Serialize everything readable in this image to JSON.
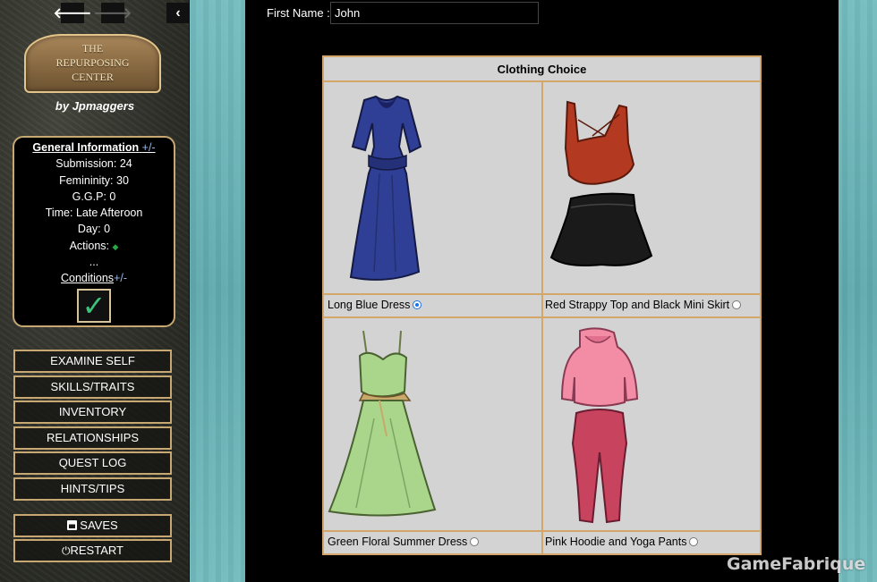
{
  "logo": {
    "line1": "THE",
    "line2": "REPURPOSING",
    "line3": "CENTER"
  },
  "byline": "by Jpmaggers",
  "info": {
    "header": "General Information",
    "toggle": "+/-",
    "submission": "Submission: 24",
    "femininity": "Femininity: 30",
    "ggp": "G.G.P: 0",
    "time": "Time: Late Afteroon",
    "day": "Day: 0",
    "actions_label": "Actions: ",
    "actions_icon": "◆",
    "ellipsis": "...",
    "conditions": "Conditions",
    "conditions_toggle": "+/-",
    "check": "✓"
  },
  "menu": {
    "examine": "EXAMINE SELF",
    "skills": "SKILLS/TRAITS",
    "inventory": "INVENTORY",
    "relationships": "RELATIONSHIPS",
    "quest": "QUEST LOG",
    "hints": "HINTS/TIPS",
    "saves": "SAVES",
    "restart": "RESTART"
  },
  "form": {
    "label": "First Name :",
    "value": "John"
  },
  "clothing": {
    "title": "Clothing Choice",
    "options": [
      {
        "label": "Long Blue Dress",
        "selected": true
      },
      {
        "label": "Red Strappy Top and Black Mini Skirt",
        "selected": false
      },
      {
        "label": "Green Floral Summer Dress",
        "selected": false
      },
      {
        "label": "Pink Hoodie and Yoga Pants",
        "selected": false
      }
    ]
  },
  "colors": {
    "panel_border": "#c8a872",
    "table_border": "#d4a66a",
    "selected_radio": "#1a73e8",
    "teal_bg": "#6cb3b6"
  },
  "watermark": "GameFabrique"
}
